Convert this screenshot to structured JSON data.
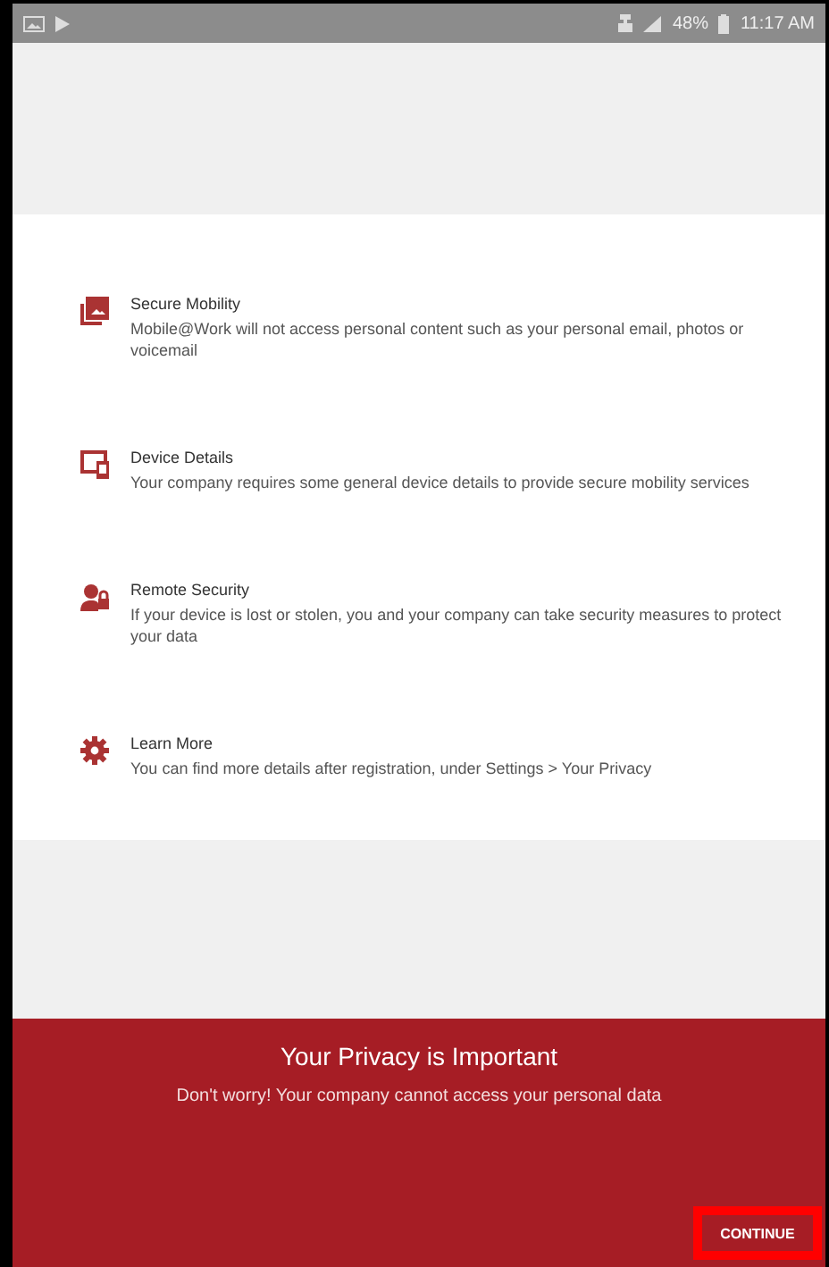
{
  "status_bar": {
    "battery": "48%",
    "time": "11:17 AM"
  },
  "items": [
    {
      "title": "Secure Mobility",
      "description": "Mobile@Work will not access personal content such as your personal email, photos or voicemail"
    },
    {
      "title": "Device Details",
      "description": "Your company requires some general device details to provide secure mobility services"
    },
    {
      "title": "Remote Security",
      "description": "If your device is lost or stolen, you and your company can take security measures to protect your data"
    },
    {
      "title": "Learn More",
      "description": "You can find more details after registration, under Settings > Your Privacy"
    }
  ],
  "footer": {
    "title": "Your Privacy is Important",
    "message": "Don't worry! Your company cannot access your personal data",
    "button": {
      "label": "CONTINUE",
      "highlighted": true
    }
  }
}
